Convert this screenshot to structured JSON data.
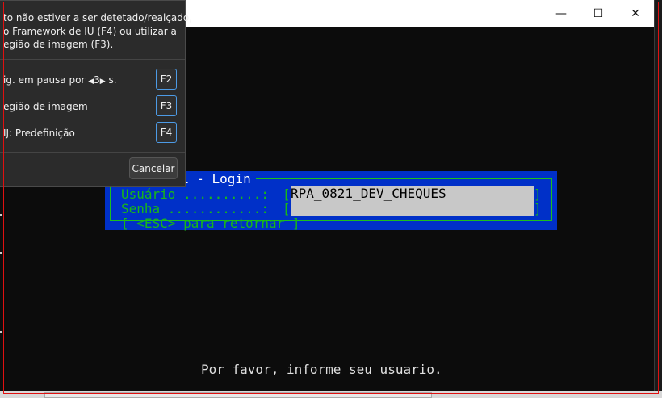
{
  "window": {
    "title": "",
    "minimize_glyph": "—",
    "maximize_glyph": "☐",
    "close_glyph": "✕"
  },
  "terminal": {
    "login_title": "i - Login",
    "usuario_label": "Usuário ..........: ",
    "senha_label": "Senha ............: ",
    "return_label": "[ <ESC> para retornar ]",
    "bracket_open": "[",
    "bracket_close": "]",
    "usuario_value": "RPA_0821_DEV_CHEQUES",
    "message": "Por favor, informe seu usuario."
  },
  "popup": {
    "info_line1": "to não estiver a ser detetado/realçado,",
    "info_line2": "o Framework de IU (F4) ou utilizar a",
    "info_line3": "egião de imagem (F3).",
    "row1_prefix": "ig. em pausa por",
    "row1_value": "3",
    "row1_suffix": "s.",
    "row1_key": "F2",
    "row2_label": "egião de imagem",
    "row2_key": "F3",
    "row3_label": "IJ: Predefinição",
    "row3_key": "F4",
    "cancel_label": "Cancelar"
  }
}
